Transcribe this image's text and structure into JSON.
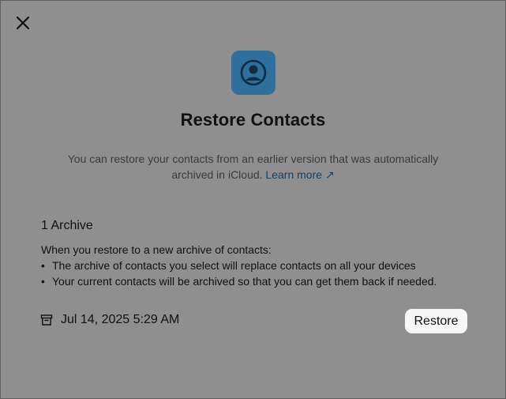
{
  "dialog": {
    "title": "Restore Contacts",
    "description": "You can restore your contacts from an earlier version that was automatically archived in iCloud.",
    "learn_more": "Learn more",
    "learn_more_arrow": "↗"
  },
  "icons": {
    "close": "close-icon",
    "app": "contacts-app-icon",
    "archive": "archive-box-icon"
  },
  "archives": {
    "count_label": "1 Archive",
    "intro": "When you restore to a new archive of contacts:",
    "bullets": [
      "The archive of contacts you select will replace contacts on all your devices",
      "Your current contacts will be archived so that you can get them back if needed."
    ],
    "items": [
      {
        "date": "Jul 14, 2025 5:29 AM",
        "action": "Restore"
      }
    ]
  },
  "colors": {
    "overlay": "#8f8f8f",
    "app_icon_bg": "#2f6f9c",
    "link": "#123f66",
    "button_bg": "#f7f7f7"
  }
}
